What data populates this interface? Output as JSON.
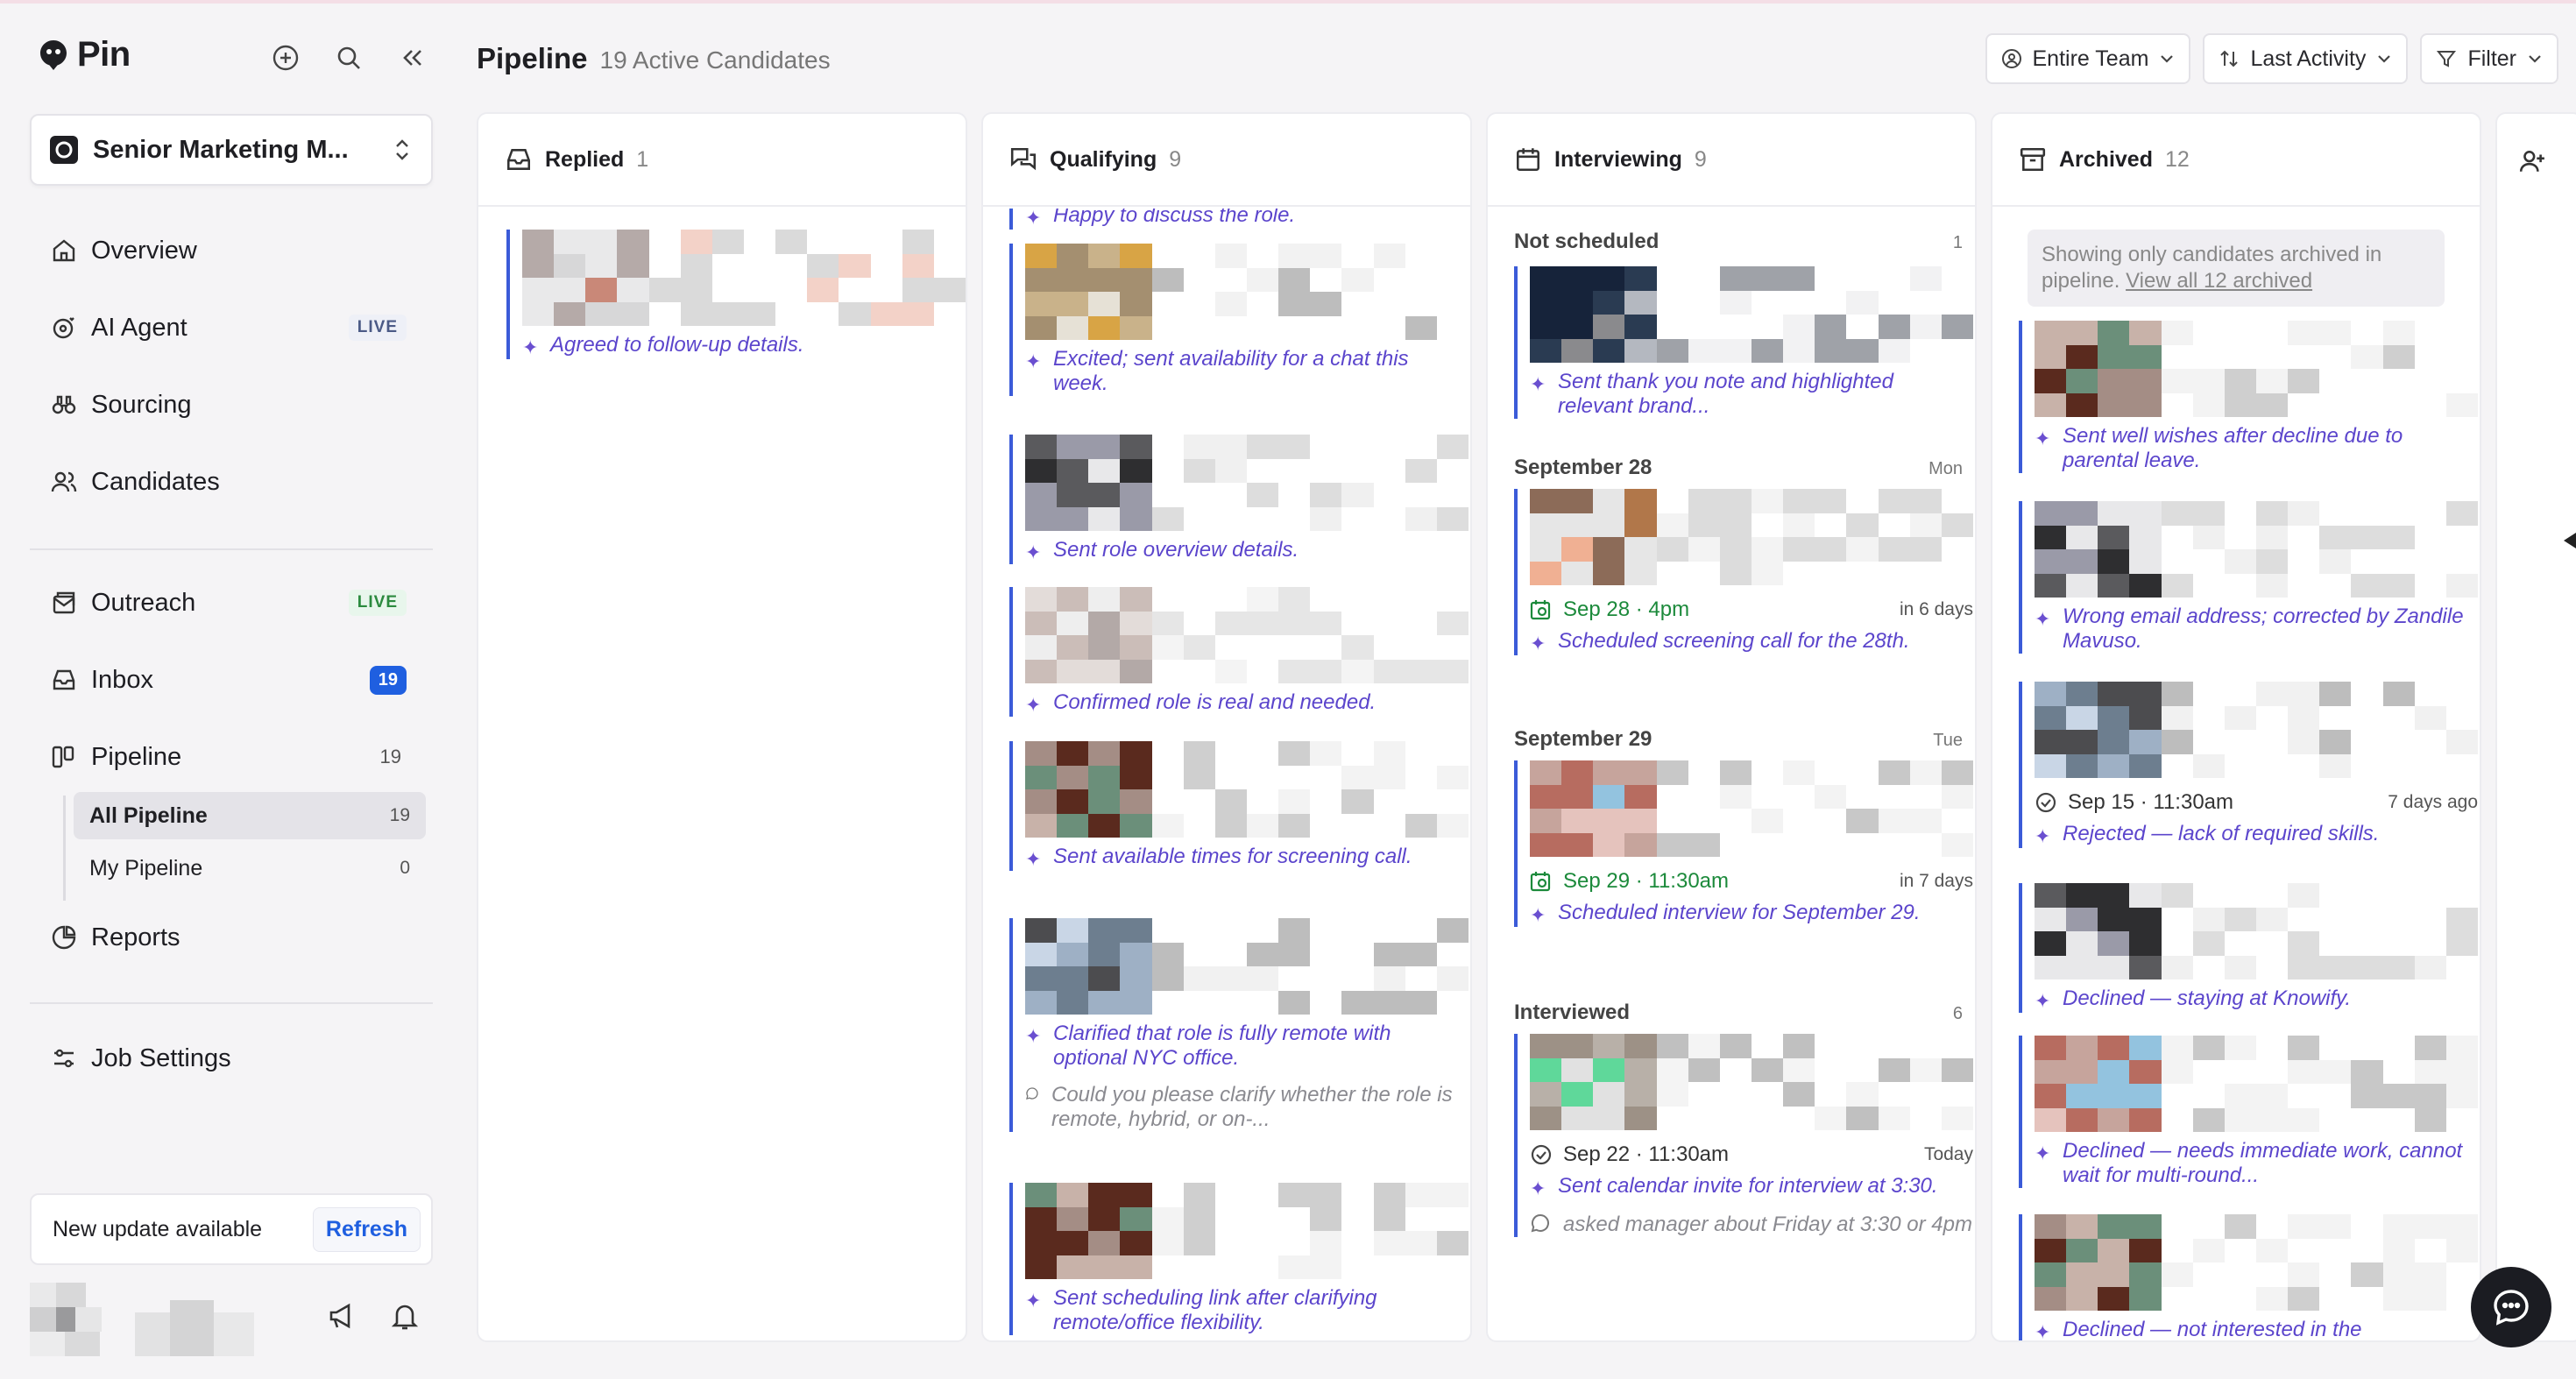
{
  "app": {
    "brand": "Pin"
  },
  "sidebar": {
    "job_title": "Senior Marketing M...",
    "nav": [
      {
        "label": "Overview"
      },
      {
        "label": "AI Agent",
        "badge": "LIVE"
      },
      {
        "label": "Sourcing"
      },
      {
        "label": "Candidates"
      },
      {
        "label": "Outreach",
        "badge": "LIVE"
      },
      {
        "label": "Inbox",
        "count": "19"
      },
      {
        "label": "Pipeline",
        "count": "19"
      },
      {
        "label": "Reports"
      },
      {
        "label": "Job Settings"
      }
    ],
    "pipeline_sub": [
      {
        "label": "All Pipeline",
        "count": "19"
      },
      {
        "label": "My Pipeline",
        "count": "0"
      }
    ],
    "update": {
      "text": "New update available",
      "button": "Refresh"
    }
  },
  "header": {
    "title": "Pipeline",
    "subtitle": "19 Active Candidates",
    "team": "Entire Team",
    "sort": "Last Activity",
    "filter": "Filter"
  },
  "columns": {
    "replied": {
      "title": "Replied",
      "count": "1",
      "cards": [
        {
          "summary": "Agreed to follow-up details."
        }
      ]
    },
    "qualifying": {
      "title": "Qualifying",
      "count": "9",
      "top_summary": "Happy to discuss the role.",
      "cards": [
        {
          "summary": "Excited; sent availability for a chat this week."
        },
        {
          "summary": "Sent role overview details."
        },
        {
          "summary": "Confirmed role is real and needed."
        },
        {
          "summary": "Sent available times for screening call."
        },
        {
          "summary": "Clarified that role is fully remote with optional NYC office.",
          "note": "Could you please clarify whether the role is remote, hybrid, or on-..."
        },
        {
          "summary": "Sent scheduling link after clarifying remote/office flexibility."
        }
      ]
    },
    "interviewing": {
      "title": "Interviewing",
      "count": "9",
      "groups": [
        {
          "title": "Not scheduled",
          "right": "1"
        },
        {
          "title": "September 28",
          "right": "Mon"
        },
        {
          "title": "September 29",
          "right": "Tue"
        },
        {
          "title": "Interviewed",
          "right": "6"
        }
      ],
      "cards": [
        {
          "summary": "Sent thank you note and highlighted relevant brand..."
        },
        {
          "schedule": "Sep 28 · 4pm",
          "relative": "in 6 days",
          "summary": "Scheduled screening call for the 28th."
        },
        {
          "schedule": "Sep 29 · 11:30am",
          "relative": "in 7 days",
          "summary": "Scheduled interview for September 29."
        },
        {
          "schedule": "Sep 22 · 11:30am",
          "relative": "Today",
          "summary": "Sent calendar invite for interview at 3:30.",
          "note": "asked manager about Friday at 3:30 or 4pm"
        }
      ]
    },
    "archived": {
      "title": "Archived",
      "count": "12",
      "note": "Showing only candidates archived in pipeline.",
      "note_link": "View all 12 archived",
      "cards": [
        {
          "summary": "Sent well wishes after decline due to parental leave."
        },
        {
          "summary": "Wrong email address; corrected by Zandile Mavuso."
        },
        {
          "schedule": "Sep 15 · 11:30am",
          "relative": "7 days ago",
          "summary": "Rejected — lack of required skills."
        },
        {
          "summary": "Declined — staying at Knowify."
        },
        {
          "summary": "Declined — needs immediate work, cannot wait for multi-round..."
        },
        {
          "summary": "Declined — not interested in the"
        }
      ]
    }
  },
  "colors": {
    "accent": "#1f5fe0",
    "ai_text": "#5b45cc",
    "live_green": "#2b8a3e",
    "card_rule": "#3b5bd8"
  }
}
